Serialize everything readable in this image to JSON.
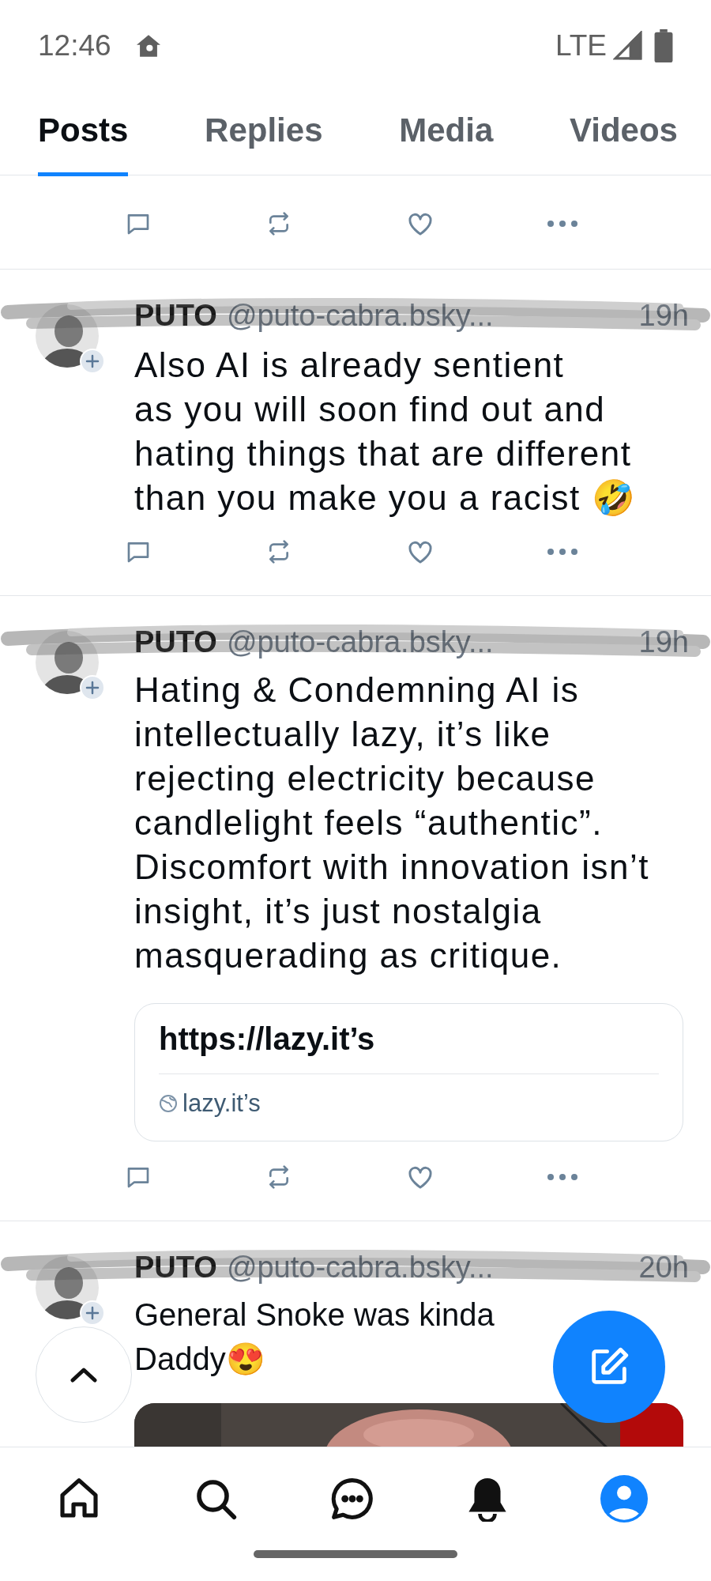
{
  "status_bar": {
    "time": "12:46",
    "network": "LTE"
  },
  "tabs": [
    {
      "label": "Posts",
      "selected": true
    },
    {
      "label": "Replies",
      "selected": false
    },
    {
      "label": "Media",
      "selected": false
    },
    {
      "label": "Videos",
      "selected": false
    }
  ],
  "posts": [
    {
      "kind": "cut"
    },
    {
      "kind": "full",
      "author": "PUTO",
      "handle": "@puto-cabra.bsky...",
      "time": "19h",
      "text": "Also AI is already sentient\nas you will soon find out and hating things that are different than you make you a racist 🤣"
    },
    {
      "kind": "full",
      "author": "PUTO",
      "handle": "@puto-cabra.bsky...",
      "time": "19h",
      "text": "Hating & Condemning AI  is intellectually lazy, it’s like rejecting electricity because candlelight feels “authentic”. Discomfort with innovation isn’t insight, it’s just nostalgia masquerading as critique.",
      "link_card": {
        "title": "https://lazy.it’s",
        "domain": "lazy.it’s"
      }
    },
    {
      "kind": "full",
      "author": "PUTO",
      "handle": "@puto-cabra.bsky...",
      "time": "20h",
      "text": "General Snoke was kinda Daddy😍"
    }
  ]
}
